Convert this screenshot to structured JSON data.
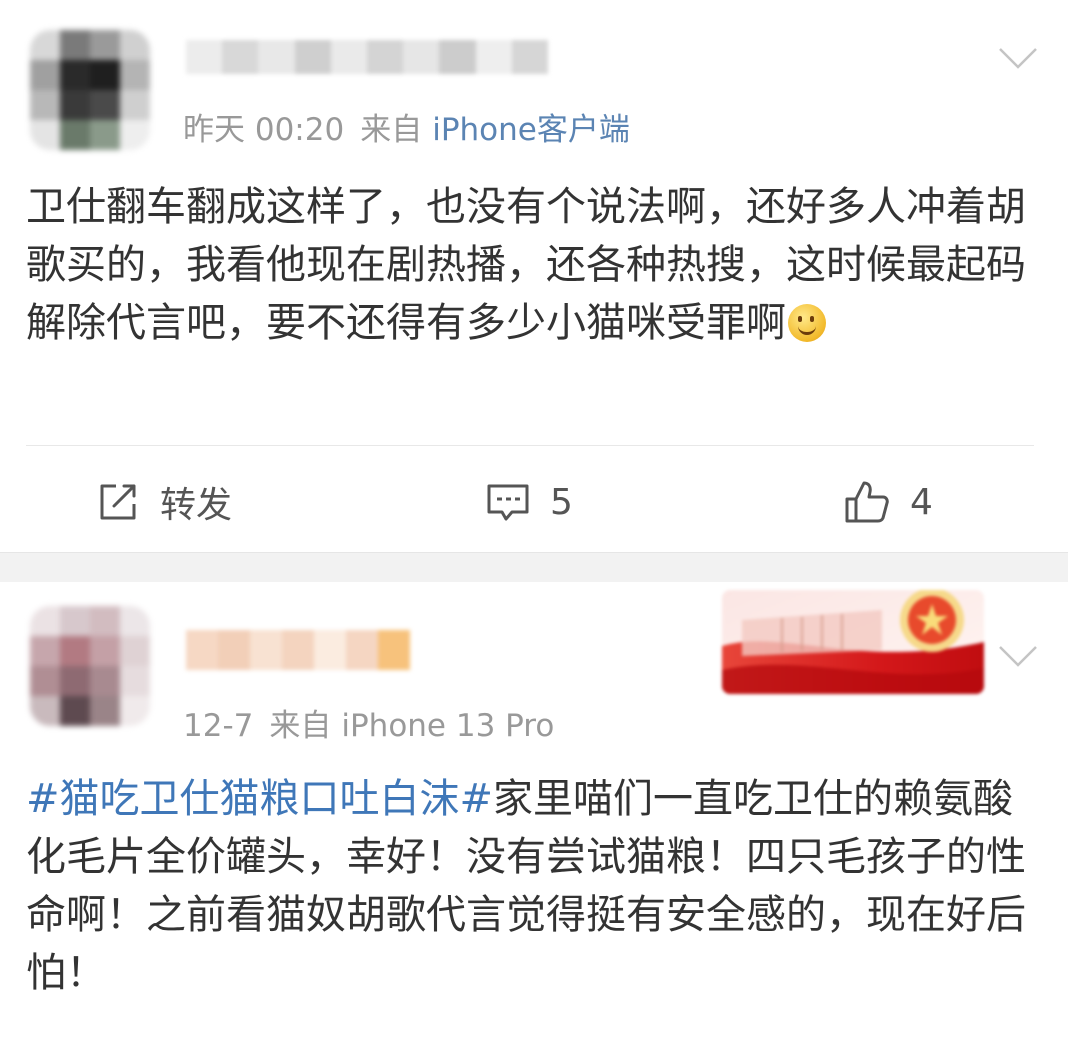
{
  "post1": {
    "time": "昨天 00:20",
    "source_prefix": "来自",
    "source": "iPhone客户端",
    "text": "卫仕翻车翻成这样了，也没有个说法啊，还好多人冲着胡歌买的，我看他现在剧热播，还各种热搜，这时候最起码解除代言吧，要不还得有多少小猫咪受罪啊",
    "emoji_icon": "smile-emoji-icon",
    "actions": {
      "repost_label": "转发",
      "comment_count": "5",
      "like_count": "4"
    }
  },
  "post2": {
    "time": "12-7",
    "source_prefix": "来自",
    "source": "iPhone 13 Pro",
    "hashtag": "#猫吃卫仕猫粮口吐白沫#",
    "text": "家里喵们一直吃卫仕的赖氨酸化毛片全价罐头，幸好！没有尝试猫粮！四只毛孩子的性命啊！之前看猫奴胡歌代言觉得挺有安全感的，现在好后怕！"
  },
  "colors": {
    "link": "#3f77b8",
    "source": "#5b84b3",
    "meta": "#999999",
    "separator": "#f2f2f2"
  }
}
